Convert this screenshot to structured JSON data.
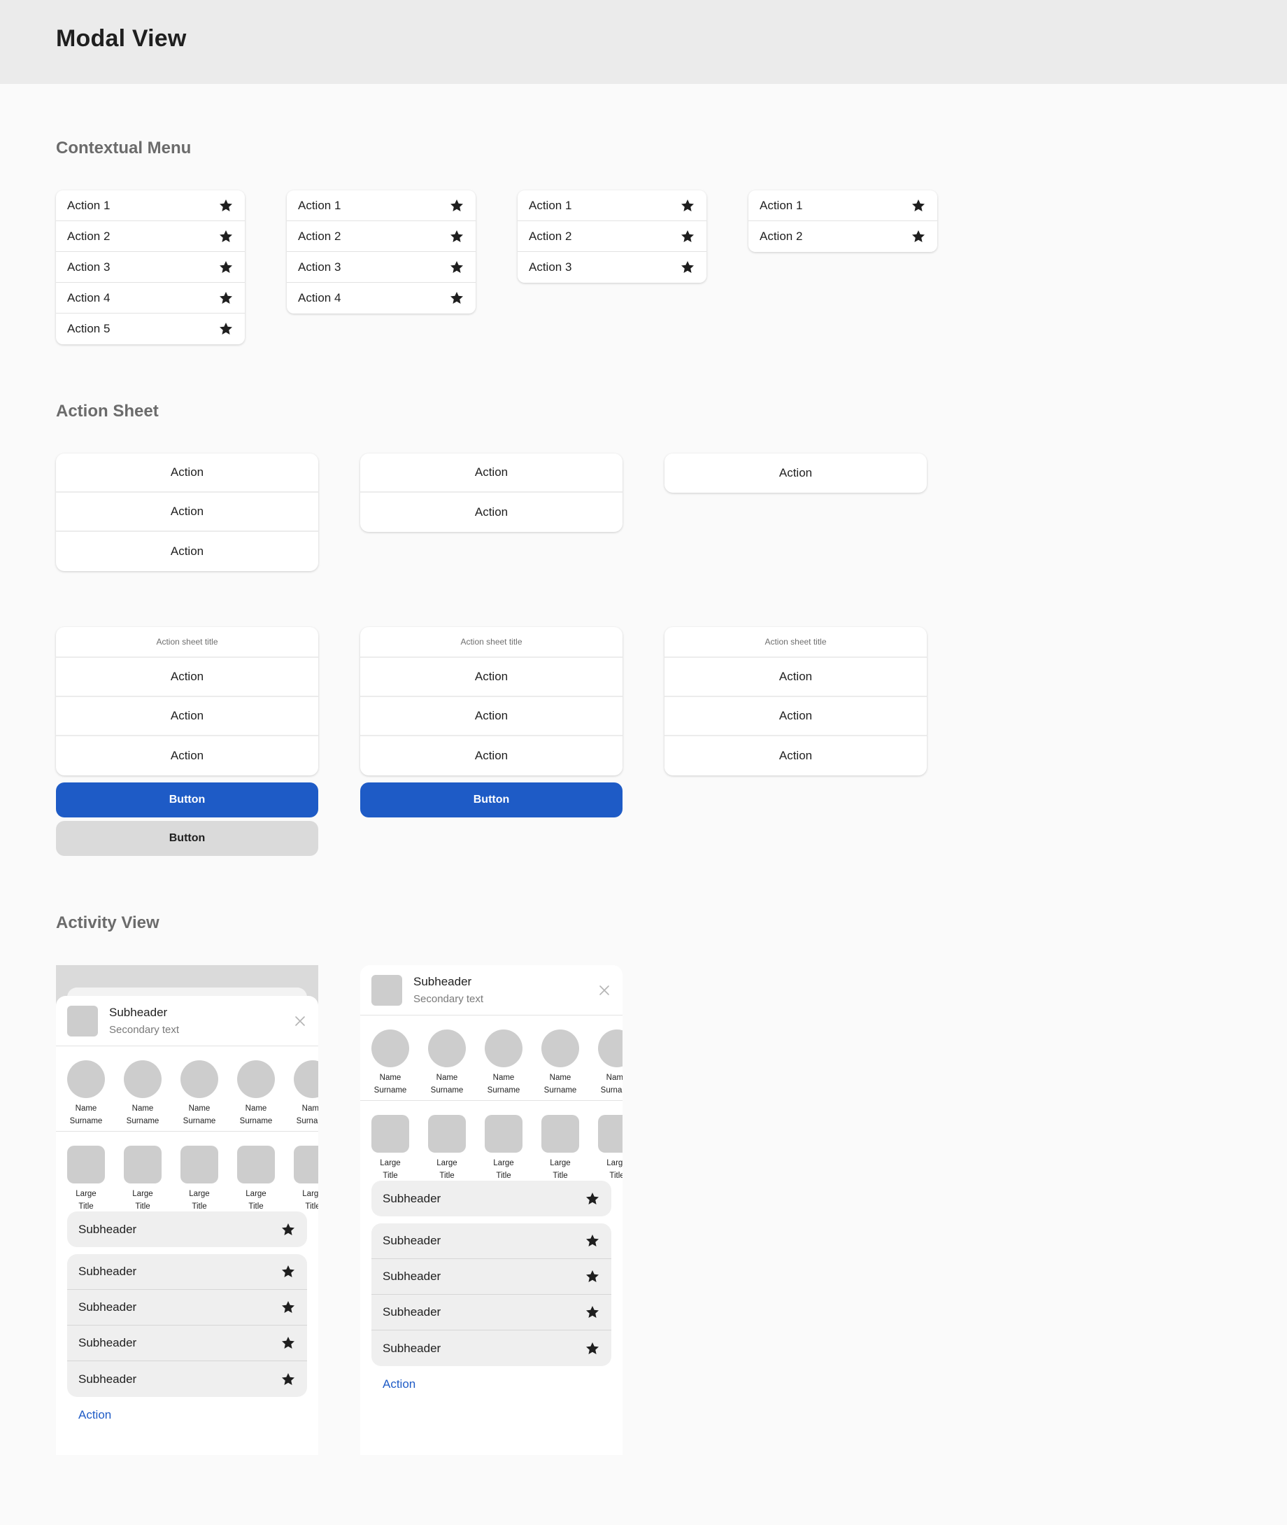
{
  "header": {
    "title": "Modal View"
  },
  "sections": {
    "contextual_menu": "Contextual Menu",
    "action_sheet": "Action Sheet",
    "activity_view": "Activity View"
  },
  "contextual_menus": [
    {
      "items": [
        "Action 1",
        "Action 2",
        "Action 3",
        "Action 4",
        "Action 5"
      ],
      "icon": "star-icon"
    },
    {
      "items": [
        "Action 1",
        "Action 2",
        "Action 3",
        "Action 4"
      ],
      "icon": "star-icon"
    },
    {
      "items": [
        "Action 1",
        "Action 2",
        "Action 3"
      ],
      "icon": "star-icon"
    },
    {
      "items": [
        "Action 1",
        "Action 2"
      ],
      "icon": "star-icon"
    }
  ],
  "action_sheets_row1": [
    {
      "actions": [
        "Action",
        "Action",
        "Action"
      ]
    },
    {
      "actions": [
        "Action",
        "Action"
      ]
    },
    {
      "actions": [
        "Action"
      ]
    }
  ],
  "action_sheets_row2": [
    {
      "title": "Action sheet title",
      "actions": [
        "Action",
        "Action",
        "Action"
      ],
      "primary_button": "Button",
      "secondary_button": "Button"
    },
    {
      "title": "Action sheet title",
      "actions": [
        "Action",
        "Action",
        "Action"
      ],
      "primary_button": "Button"
    },
    {
      "title": "Action sheet title",
      "actions": [
        "Action",
        "Action",
        "Action"
      ]
    }
  ],
  "activity_views": [
    {
      "subheader": "Subheader",
      "secondary": "Secondary text",
      "people": [
        [
          "Name",
          "Surname"
        ],
        [
          "Name",
          "Surname"
        ],
        [
          "Name",
          "Surname"
        ],
        [
          "Name",
          "Surname"
        ],
        [
          "Name",
          "Surname"
        ]
      ],
      "apps": [
        [
          "Large",
          "Title"
        ],
        [
          "Large",
          "Title"
        ],
        [
          "Large",
          "Title"
        ],
        [
          "Large",
          "Title"
        ],
        [
          "Large",
          "Title"
        ]
      ],
      "single_row": "Subheader",
      "group_rows": [
        "Subheader",
        "Subheader",
        "Subheader",
        "Subheader"
      ],
      "link": "Action"
    },
    {
      "subheader": "Subheader",
      "secondary": "Secondary text",
      "people": [
        [
          "Name",
          "Surname"
        ],
        [
          "Name",
          "Surname"
        ],
        [
          "Name",
          "Surname"
        ],
        [
          "Name",
          "Surname"
        ],
        [
          "Name",
          "Surname"
        ]
      ],
      "apps": [
        [
          "Large",
          "Title"
        ],
        [
          "Large",
          "Title"
        ],
        [
          "Large",
          "Title"
        ],
        [
          "Large",
          "Title"
        ],
        [
          "Large",
          "Title"
        ]
      ],
      "single_row": "Subheader",
      "group_rows": [
        "Subheader",
        "Subheader",
        "Subheader",
        "Subheader"
      ],
      "link": "Action"
    }
  ],
  "colors": {
    "accent": "#1e5bc6",
    "secondary_button": "#dadada",
    "header_bg": "#ebebeb",
    "page_bg": "#fafafa",
    "placeholder": "#cdcdcd"
  }
}
